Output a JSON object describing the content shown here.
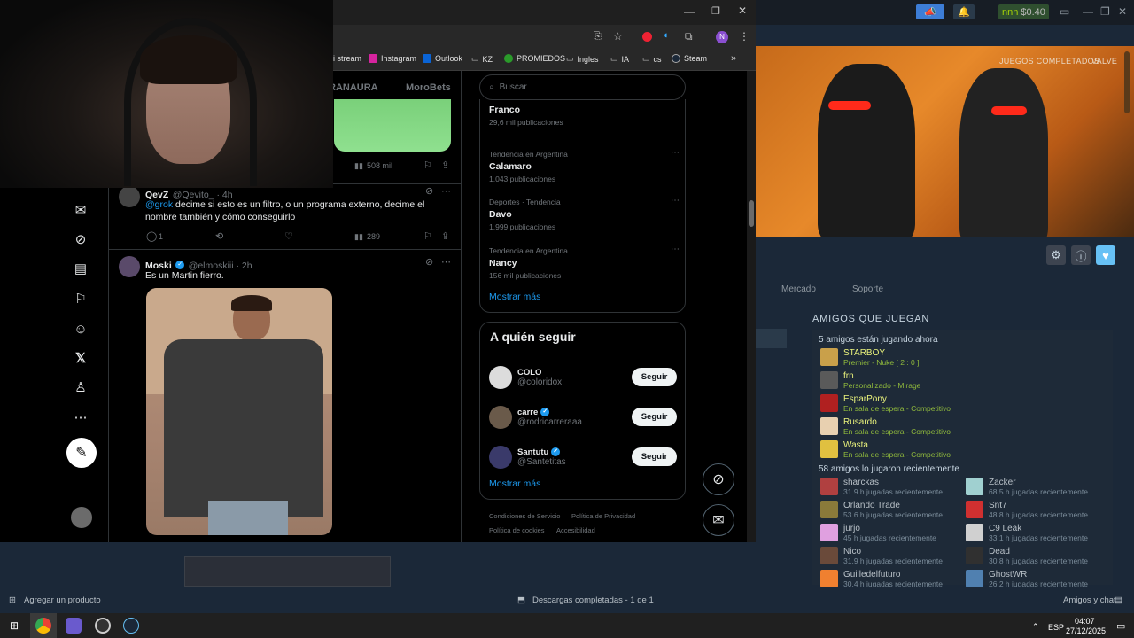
{
  "steam": {
    "wallet_user": "nnn",
    "wallet_amount": "$0.40",
    "hero_tags": [
      "JUEGOS COMPLETADOS",
      "VALVE"
    ],
    "nav": [
      "Mercado",
      "Soporte"
    ],
    "friends_title": "AMIGOS QUE JUEGAN",
    "playing_now_header": "5 amigos están jugando ahora",
    "playing_now": [
      {
        "name": "STARBOY",
        "status": "Premier - Nuke [ 2 : 0 ]",
        "color": "#c9a04a"
      },
      {
        "name": "frn",
        "status": "Personalizado - Mirage",
        "color": "#5a5a5a"
      },
      {
        "name": "EsparPony",
        "status": "En sala de espera - Competitivo",
        "color": "#b02020"
      },
      {
        "name": "Rusardo",
        "status": "En sala de espera - Competitivo",
        "color": "#e8d0b0"
      },
      {
        "name": "Wasta",
        "status": "En sala de espera - Competitivo",
        "color": "#e0c040"
      }
    ],
    "recent_header": "58 amigos lo jugaron recientemente",
    "recent_left": [
      {
        "name": "sharckas",
        "hours": "31.9 h jugadas recientemente",
        "color": "#b04040"
      },
      {
        "name": "Orlando Trade",
        "hours": "53.6 h jugadas recientemente",
        "color": "#8a7a3a"
      },
      {
        "name": "jurjo",
        "hours": "45 h jugadas recientemente",
        "color": "#e0a0e0"
      },
      {
        "name": "Nico",
        "hours": "31.9 h jugadas recientemente",
        "color": "#6a4a3a"
      },
      {
        "name": "Guilledelfuturo",
        "hours": "30.4 h jugadas recientemente",
        "color": "#f08030"
      }
    ],
    "recent_right": [
      {
        "name": "Zacker",
        "hours": "68.5 h jugadas recientemente",
        "color": "#a0d0d0"
      },
      {
        "name": "Snt7",
        "hours": "48.8 h jugadas recientemente",
        "color": "#d03030"
      },
      {
        "name": "C9 Leak",
        "hours": "33.1 h jugadas recientemente",
        "color": "#d0d0d0"
      },
      {
        "name": "Dead",
        "hours": "30.8 h jugadas recientemente",
        "color": "#303030"
      },
      {
        "name": "GhostWR",
        "hours": "26.2 h jugadas recientemente",
        "color": "#5080b0"
      }
    ],
    "add_product": "Agregar un producto",
    "downloads": "Descargas completadas - 1 de 1",
    "friends_chat": "Amigos y chat"
  },
  "taskbar": {
    "lang": "ESP",
    "time": "04:07",
    "date": "27/12/2025"
  },
  "browser": {
    "bookmarks": [
      "i stream",
      "Instagram",
      "Outlook",
      "KZ",
      "PROMIEDOS",
      "Ingles",
      "IA",
      "cs",
      "Steam"
    ],
    "profile_letter": "N"
  },
  "twitter": {
    "tabs": [
      "RANAURA",
      "MoroBets"
    ],
    "prev_views": "508 mil",
    "tweet1": {
      "name": "QevZ",
      "handle": "@Qevito_ · 4h",
      "mention": "@grok",
      "text": " decime si esto es un filtro, o un programa externo, decime el nombre también y cómo conseguirlo",
      "replies": "1",
      "views": "289"
    },
    "tweet2": {
      "name": "Moski",
      "handle": "@elmoskiii · 2h",
      "text": "Es un Martin fierro."
    },
    "search_placeholder": "Buscar",
    "trends": [
      {
        "cat": "",
        "name": "Franco",
        "count": "29,6 mil publicaciones"
      },
      {
        "cat": "Tendencia en Argentina",
        "name": "Calamaro",
        "count": "1.043 publicaciones"
      },
      {
        "cat": "Deportes · Tendencia",
        "name": "Davo",
        "count": "1.999 publicaciones"
      },
      {
        "cat": "Tendencia en Argentina",
        "name": "Nancy",
        "count": "156 mil publicaciones"
      }
    ],
    "show_more": "Mostrar más",
    "who_title": "A quién seguir",
    "who": [
      {
        "name": "COLO",
        "handle": "@coloridox",
        "color": "#dcdcdc"
      },
      {
        "name": "carre",
        "handle": "@rodricarreraaa",
        "color": "#6a5a4a"
      },
      {
        "name": "Santutu",
        "handle": "@Santetitas",
        "color": "#3a3a6a"
      }
    ],
    "follow_label": "Seguir",
    "footer": [
      "Condiciones de Servicio",
      "Política de Privacidad",
      "Política de cookies",
      "Accesibilidad"
    ]
  }
}
